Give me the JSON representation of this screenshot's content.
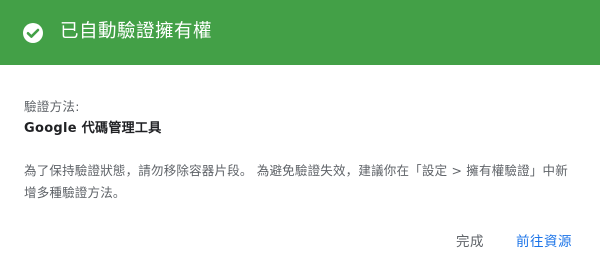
{
  "colors": {
    "header_background": "#43a047",
    "header_text": "#ffffff",
    "primary_action": "#1a73e8"
  },
  "header": {
    "icon": "check-circle-icon",
    "title": "已自動驗證擁有權"
  },
  "verification": {
    "method_label": "驗證方法:",
    "method_value": "Google 代碼管理工具"
  },
  "message": "為了保持驗證狀態，請勿移除容器片段。 為避免驗證失效，建議你在「設定 > 擁有權驗證」中新增多種驗證方法。",
  "actions": {
    "done_label": "完成",
    "go_to_property_label": "前往資源"
  }
}
